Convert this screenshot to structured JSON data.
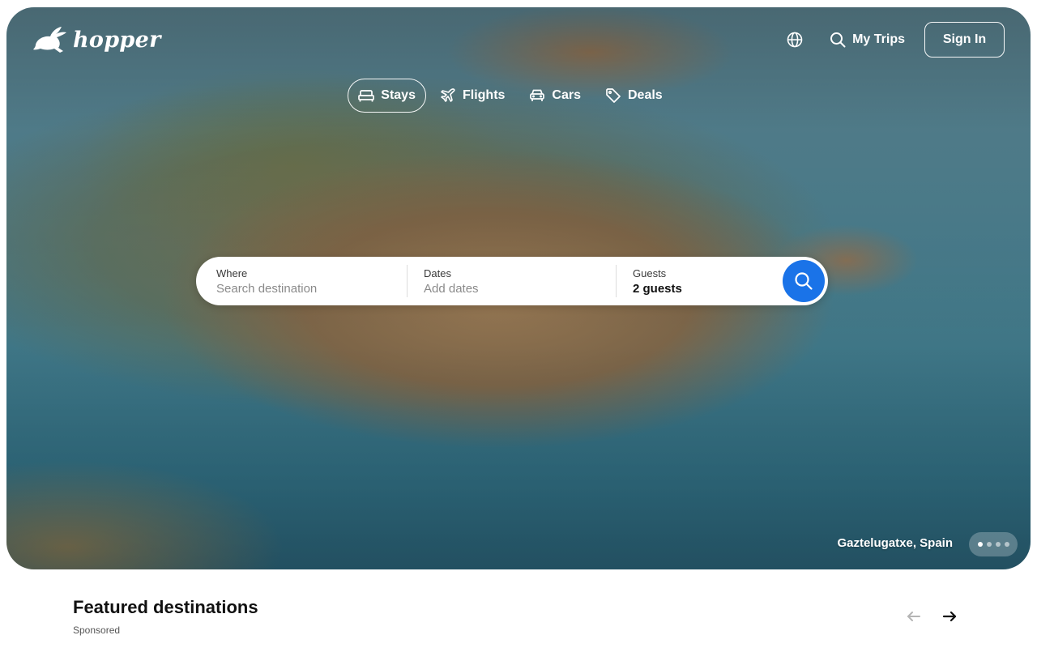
{
  "brand": {
    "name": "hopper"
  },
  "header": {
    "language_icon": "globe-icon",
    "my_trips_label": "My Trips",
    "sign_in_label": "Sign In"
  },
  "tabs": [
    {
      "label": "Stays",
      "icon": "bed-icon",
      "active": true
    },
    {
      "label": "Flights",
      "icon": "plane-icon",
      "active": false
    },
    {
      "label": "Cars",
      "icon": "car-icon",
      "active": false
    },
    {
      "label": "Deals",
      "icon": "tag-icon",
      "active": false
    }
  ],
  "search": {
    "where_label": "Where",
    "where_placeholder": "Search destination",
    "dates_label": "Dates",
    "dates_placeholder": "Add dates",
    "guests_label": "Guests",
    "guests_value": "2 guests"
  },
  "hero": {
    "location_caption": "Gaztelugatxe, Spain",
    "slide_count": 4,
    "active_slide": 1
  },
  "featured": {
    "title": "Featured destinations",
    "subtitle": "Sponsored"
  },
  "colors": {
    "accent": "#1a73e8",
    "text": "#111111"
  }
}
